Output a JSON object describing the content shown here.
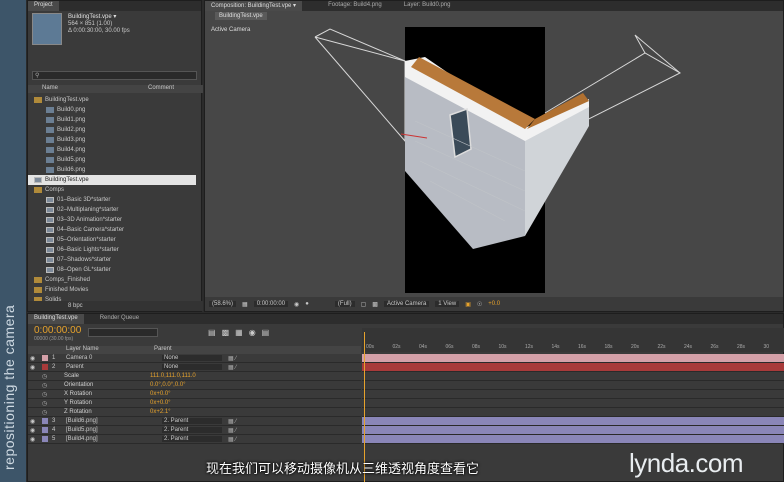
{
  "sidebar_text": "repositioning the camera",
  "project": {
    "tab": "Project",
    "item_name": "BuildingTest.vpe ▾",
    "item_info1": "564 × 851 (1.00)",
    "item_info2": "Δ 0:00:30:00, 30.00 fps",
    "col_name": "Name",
    "col_comment": "Comment",
    "tree": [
      {
        "label": "BuildingTest.vpe",
        "type": "folder",
        "indent": 0
      },
      {
        "label": "Build0.png",
        "type": "file",
        "indent": 1
      },
      {
        "label": "Build1.png",
        "type": "file",
        "indent": 1
      },
      {
        "label": "Build2.png",
        "type": "file",
        "indent": 1
      },
      {
        "label": "Build3.png",
        "type": "file",
        "indent": 1
      },
      {
        "label": "Build4.png",
        "type": "file",
        "indent": 1
      },
      {
        "label": "Build5.png",
        "type": "file",
        "indent": 1
      },
      {
        "label": "Build6.png",
        "type": "file",
        "indent": 1
      },
      {
        "label": "BuildingTest.vpe",
        "type": "comp",
        "indent": 0,
        "selected": true
      },
      {
        "label": "Comps",
        "type": "folder",
        "indent": 0
      },
      {
        "label": "01–Basic 3D*starter",
        "type": "comp",
        "indent": 1
      },
      {
        "label": "02–Multiplaning*starter",
        "type": "comp",
        "indent": 1
      },
      {
        "label": "03–3D Animation*starter",
        "type": "comp",
        "indent": 1
      },
      {
        "label": "04–Basic Camera*starter",
        "type": "comp",
        "indent": 1
      },
      {
        "label": "05–Orientation*starter",
        "type": "comp",
        "indent": 1
      },
      {
        "label": "06–Basic Lights*starter",
        "type": "comp",
        "indent": 1
      },
      {
        "label": "07–Shadows*starter",
        "type": "comp",
        "indent": 1
      },
      {
        "label": "08–Open GL*starter",
        "type": "comp",
        "indent": 1
      },
      {
        "label": "Comps_Finished",
        "type": "folder",
        "indent": 0
      },
      {
        "label": "Finished Movies",
        "type": "folder",
        "indent": 0
      },
      {
        "label": "Solids",
        "type": "folder",
        "indent": 0
      }
    ],
    "bpc": "8 bpc"
  },
  "composition": {
    "tabs": [
      "Composition: BuildingTest.vpe ▾",
      "Footage: Build4.png",
      "Layer: Build0.png"
    ],
    "subtab": "BuildingTest.vpe",
    "active_camera_label": "Active Camera",
    "zoom": "(58.6%)",
    "timecode": "0:00:00:00",
    "resolution": "(Full)",
    "view": "Active Camera",
    "views": "1 View",
    "exposure": "+0.0"
  },
  "timeline": {
    "tabs": [
      "BuildingTest.vpe",
      "Render Queue"
    ],
    "timecode": "0:00:00:00",
    "fps_info": "00000 (30.00 fps)",
    "col_layer": "Layer Name",
    "col_parent": "Parent",
    "ruler": [
      "00s",
      "02s",
      "04s",
      "06s",
      "08s",
      "10s",
      "12s",
      "14s",
      "16s",
      "18s",
      "20s",
      "22s",
      "24s",
      "26s",
      "28s",
      "30"
    ],
    "layers": [
      {
        "num": "1",
        "name": "Camera 0",
        "parent": "None",
        "color": "#d4a0a8"
      },
      {
        "num": "2",
        "name": "Parent",
        "parent": "None",
        "color": "#a83a3a"
      }
    ],
    "props": [
      {
        "name": "Scale",
        "value": "111.0,111.0,111.0"
      },
      {
        "name": "Orientation",
        "value": "0.0°,0.0°,0.0°"
      },
      {
        "name": "X Rotation",
        "value": "0x+0.0°"
      },
      {
        "name": "Y Rotation",
        "value": "0x+0.0°"
      },
      {
        "name": "Z Rotation",
        "value": "0x+2.1°"
      }
    ],
    "lower_layers": [
      {
        "num": "3",
        "name": "[Build6.png]",
        "parent": "2. Parent"
      },
      {
        "num": "4",
        "name": "[Build5.png]",
        "parent": "2. Parent"
      },
      {
        "num": "5",
        "name": "[Build4.png]",
        "parent": "2. Parent"
      }
    ],
    "lower_color": "#8a86b8"
  },
  "subtitle": "现在我们可以移动摄像机从三维透视角度查看它",
  "brand": "lynda.com"
}
